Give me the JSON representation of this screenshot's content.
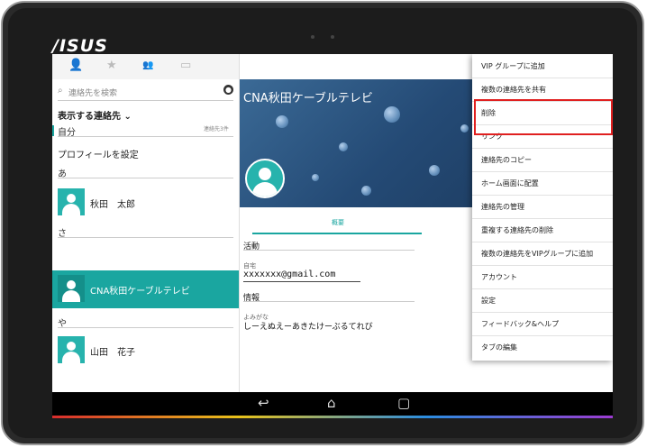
{
  "device": {
    "brand": "/ISUS"
  },
  "tabs": [
    {
      "name": "person-icon",
      "glyph": "👤"
    },
    {
      "name": "star-icon",
      "glyph": "★"
    },
    {
      "name": "group-icon",
      "glyph": "👥"
    },
    {
      "name": "vip-icon",
      "glyph": "▭"
    }
  ],
  "search": {
    "placeholder": "連絡先を検索"
  },
  "left": {
    "show_label": "表示する連絡先 ⌄",
    "section_me": "自分",
    "me_count": "連絡先3件",
    "profile": "プロフィールを設定",
    "section_a": "あ",
    "contact_1": "秋田　太郎",
    "section_sa": "さ",
    "contact_2": "CNA秋田ケーブルテレビ",
    "section_ya": "や",
    "contact_3": "山田　花子"
  },
  "detail": {
    "title": "CNA秋田ケーブルテレビ",
    "tab": "概要",
    "activity": "活動",
    "home_label": "自宅",
    "email": "xxxxxxx@gmail.com",
    "info": "情報",
    "yomi_label": "よみがな",
    "yomi": "しーえぬえーあきたけーぶるてれび"
  },
  "menu": {
    "items": [
      "VIP グループに追加",
      "複数の連絡先を共有",
      "削除",
      "リンク",
      "連絡先のコピー",
      "ホーム画面に配置",
      "連絡先の管理",
      "重複する連絡先の削除",
      "複数の連絡先をVIPグループに追加",
      "アカウント",
      "設定",
      "フィードバック&ヘルプ",
      "タブの編集"
    ]
  },
  "navbar": {
    "back": "↩",
    "home": "⌂",
    "recent": "▢"
  },
  "colors": {
    "accent": "#1aa6a0",
    "highlight": "#e02020"
  }
}
